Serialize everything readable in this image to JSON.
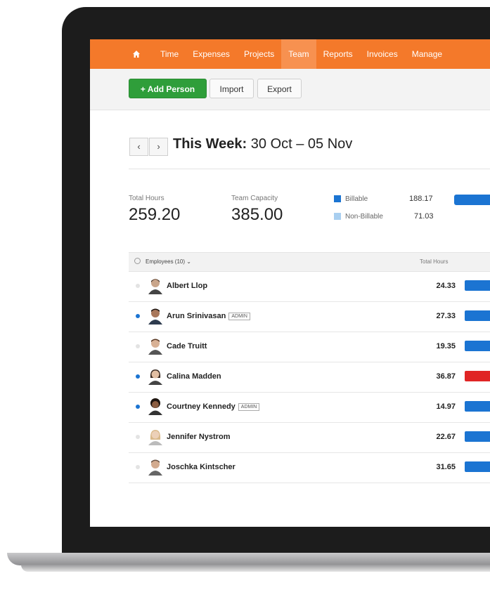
{
  "colors": {
    "nav_bg": "#f4792a",
    "primary_button": "#2f9e3a",
    "billable": "#1b74d2",
    "non_billable": "#a9cff0",
    "over_capacity": "#e02525",
    "active_dot": "#1b74d2",
    "inactive_dot": "#e3e3e3"
  },
  "nav": {
    "home_icon": "home-icon",
    "items": [
      {
        "label": "Time"
      },
      {
        "label": "Expenses"
      },
      {
        "label": "Projects"
      },
      {
        "label": "Team",
        "active": true
      },
      {
        "label": "Reports"
      },
      {
        "label": "Invoices"
      },
      {
        "label": "Manage"
      }
    ]
  },
  "toolbar": {
    "add_person_label": "+ Add Person",
    "import_label": "Import",
    "export_label": "Export"
  },
  "week": {
    "prev_glyph": "‹",
    "next_glyph": "›",
    "title_bold": "This Week:",
    "title_range": " 30 Oct – 05 Nov"
  },
  "stats": {
    "total_hours_label": "Total Hours",
    "total_hours_value": "259.20",
    "capacity_label": "Team Capacity",
    "capacity_value": "385.00",
    "billable_label": "Billable",
    "billable_value": "188.17",
    "non_billable_label": "Non-Billable",
    "non_billable_value": "71.03"
  },
  "table": {
    "employees_header": "Employees (10)",
    "employees_caret": "⌄",
    "total_hours_header": "Total Hours",
    "rows": [
      {
        "name": "Albert Llop",
        "admin": "",
        "hours": "24.33",
        "active": false,
        "over": false
      },
      {
        "name": "Arun Srinivasan",
        "admin": "ADMIN",
        "hours": "27.33",
        "active": true,
        "over": false
      },
      {
        "name": "Cade Truitt",
        "admin": "",
        "hours": "19.35",
        "active": false,
        "over": false
      },
      {
        "name": "Calina Madden",
        "admin": "",
        "hours": "36.87",
        "active": true,
        "over": true
      },
      {
        "name": "Courtney Kennedy",
        "admin": "ADMIN",
        "hours": "14.97",
        "active": true,
        "over": false
      },
      {
        "name": "Jennifer Nystrom",
        "admin": "",
        "hours": "22.67",
        "active": false,
        "over": false
      },
      {
        "name": "Joschka Kintscher",
        "admin": "",
        "hours": "31.65",
        "active": false,
        "over": false
      }
    ]
  }
}
